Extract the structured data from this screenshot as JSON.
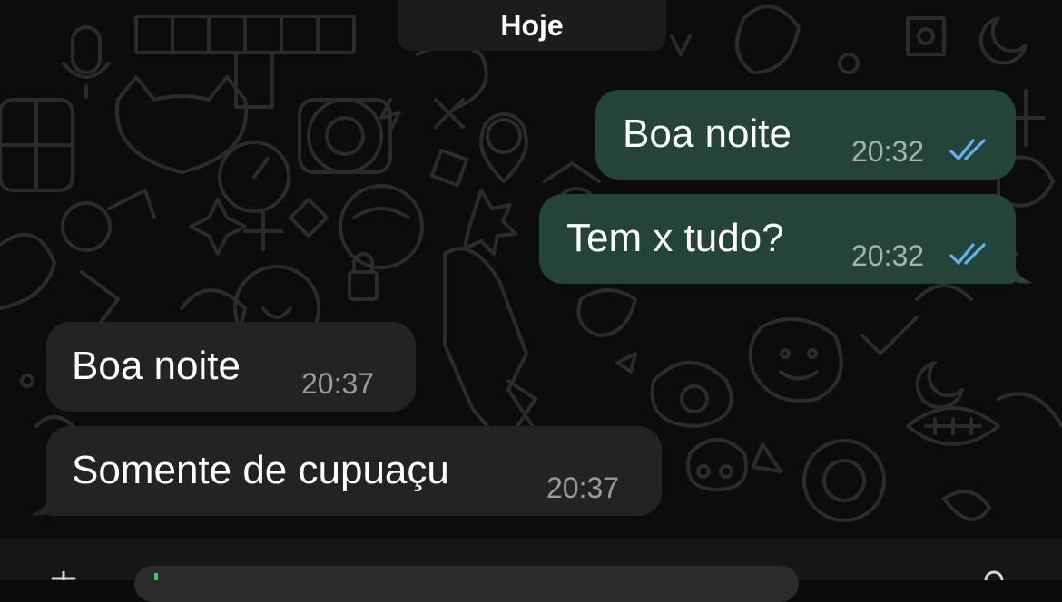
{
  "date_chip": "Hoje",
  "messages": [
    {
      "direction": "out",
      "text": "Boa noite",
      "time": "20:32",
      "status": "read"
    },
    {
      "direction": "out",
      "text": "Tem x tudo?",
      "time": "20:32",
      "status": "read"
    },
    {
      "direction": "in",
      "text": "Boa noite",
      "time": "20:37"
    },
    {
      "direction": "in",
      "text": "Somente de cupuaçu",
      "time": "20:37"
    }
  ],
  "colors": {
    "outgoing_bubble": "#24443a",
    "incoming_bubble": "#232323",
    "read_ticks": "#5eb5f0",
    "background": "#0c0c0c"
  },
  "icons": [
    "read-ticks-icon",
    "plus-icon",
    "microphone-icon"
  ]
}
